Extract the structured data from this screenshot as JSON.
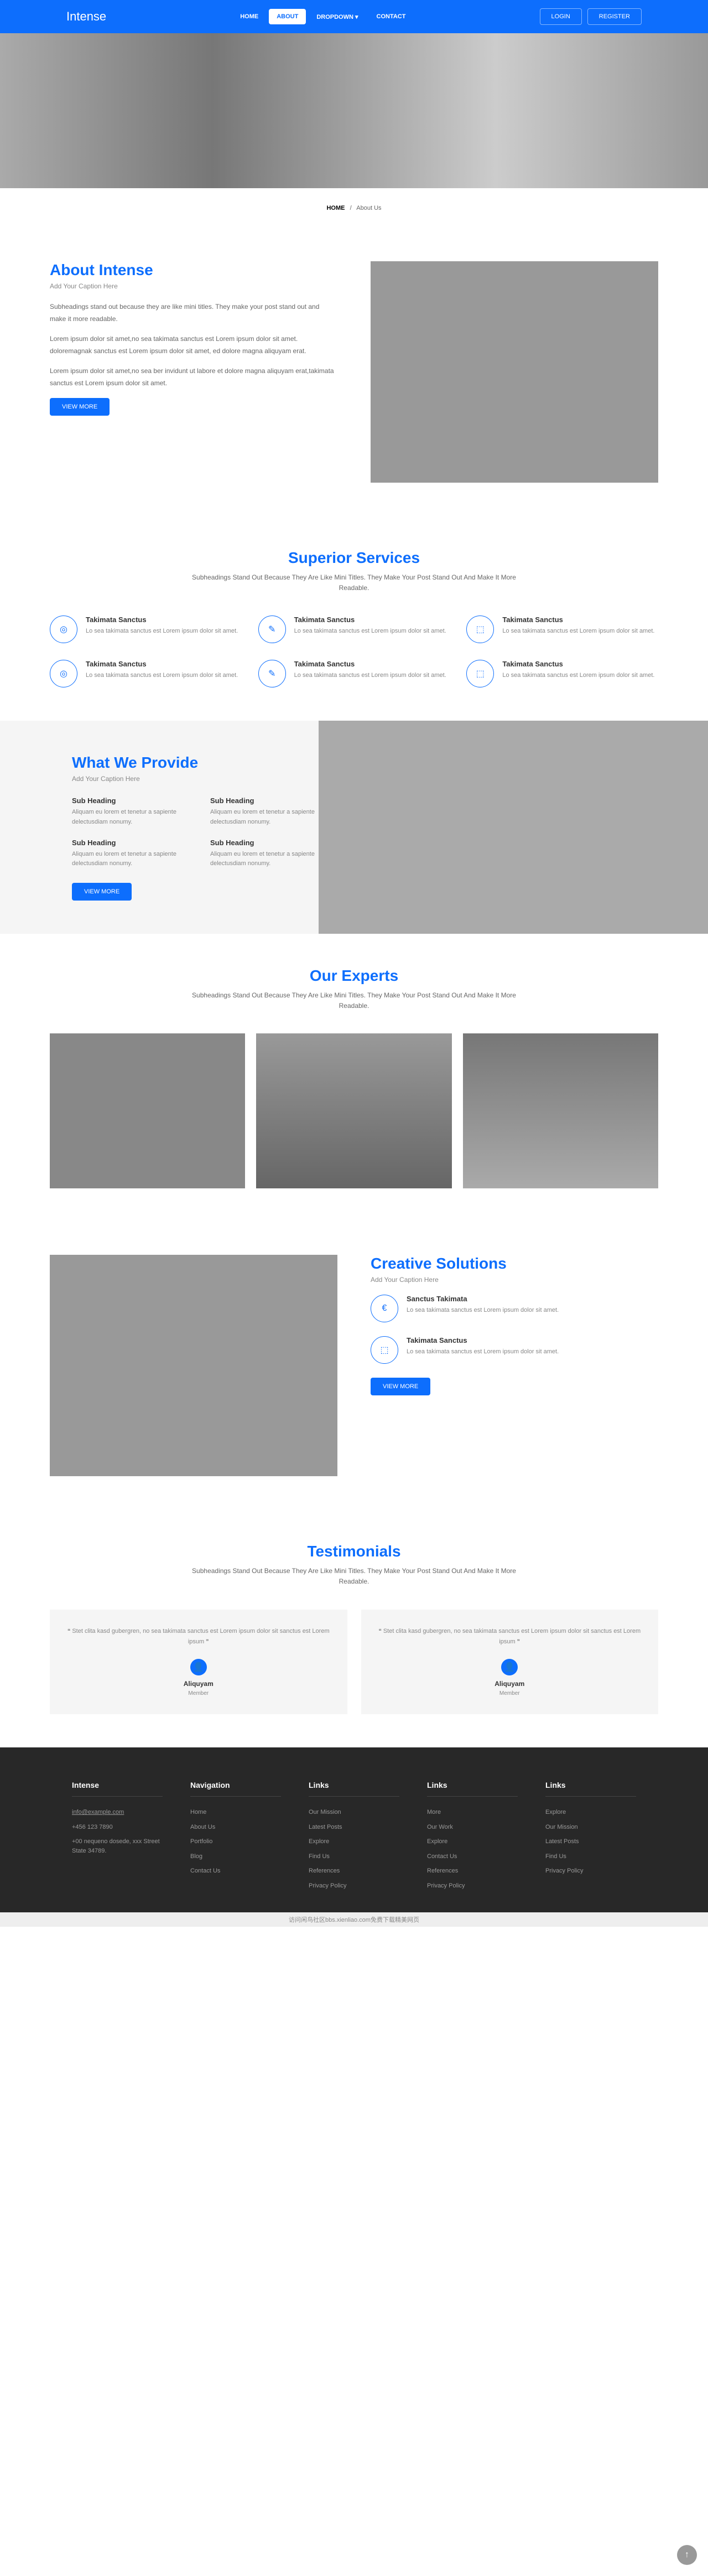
{
  "brand": "Intense",
  "nav": {
    "home": "HOME",
    "about": "ABOUT",
    "dropdown": "DROPDOWN ▾",
    "contact": "CONTACT"
  },
  "auth": {
    "login": "LOGIN",
    "register": "REGISTER"
  },
  "breadcrumb": {
    "home": "HOME",
    "sep": "/",
    "current": "About Us"
  },
  "about": {
    "title": "About Intense",
    "caption": "Add Your Caption Here",
    "p1": "Subheadings stand out because they are like mini titles. They make your post stand out and make it more readable.",
    "p2": "Lorem ipsum dolor sit amet,no sea takimata sanctus est Lorem ipsum dolor sit amet. doloremagnak sanctus est Lorem ipsum dolor sit amet, ed dolore magna aliquyam erat.",
    "p3": "Lorem ipsum dolor sit amet,no sea ber invidunt ut labore et dolore magna aliquyam erat,takimata sanctus est Lorem ipsum dolor sit amet.",
    "btn": "VIEW MORE"
  },
  "services": {
    "title": "Superior Services",
    "sub": "Subheadings Stand Out Because They Are Like Mini Titles. They Make Your Post Stand Out And Make It More Readable.",
    "items": [
      {
        "title": "Takimata Sanctus",
        "text": "Lo sea takimata sanctus est Lorem ipsum dolor sit amet."
      },
      {
        "title": "Takimata Sanctus",
        "text": "Lo sea takimata sanctus est Lorem ipsum dolor sit amet."
      },
      {
        "title": "Takimata Sanctus",
        "text": "Lo sea takimata sanctus est Lorem ipsum dolor sit amet."
      },
      {
        "title": "Takimata Sanctus",
        "text": "Lo sea takimata sanctus est Lorem ipsum dolor sit amet."
      },
      {
        "title": "Takimata Sanctus",
        "text": "Lo sea takimata sanctus est Lorem ipsum dolor sit amet."
      },
      {
        "title": "Takimata Sanctus",
        "text": "Lo sea takimata sanctus est Lorem ipsum dolor sit amet."
      }
    ]
  },
  "provide": {
    "title": "What We Provide",
    "caption": "Add Your Caption Here",
    "items": [
      {
        "title": "Sub Heading",
        "text": "Aliquam eu lorem et tenetur a sapiente delectusdiam nonumy."
      },
      {
        "title": "Sub Heading",
        "text": "Aliquam eu lorem et tenetur a sapiente delectusdiam nonumy."
      },
      {
        "title": "Sub Heading",
        "text": "Aliquam eu lorem et tenetur a sapiente delectusdiam nonumy."
      },
      {
        "title": "Sub Heading",
        "text": "Aliquam eu lorem et tenetur a sapiente delectusdiam nonumy."
      }
    ],
    "btn": "View More"
  },
  "experts": {
    "title": "Our Experts",
    "sub": "Subheadings Stand Out Because They Are Like Mini Titles. They Make Your Post Stand Out And Make It More Readable."
  },
  "creative": {
    "title": "Creative Solutions",
    "caption": "Add Your Caption Here",
    "items": [
      {
        "title": "Sanctus Takimata",
        "text": "Lo sea takimata sanctus est Lorem ipsum dolor sit amet."
      },
      {
        "title": "Takimata Sanctus",
        "text": "Lo sea takimata sanctus est Lorem ipsum dolor sit amet."
      }
    ],
    "btn": "View More"
  },
  "testimonials": {
    "title": "Testimonials",
    "sub": "Subheadings Stand Out Because They Are Like Mini Titles. They Make Your Post Stand Out And Make It More Readable.",
    "items": [
      {
        "text": "Stet clita kasd gubergren, no sea takimata sanctus est Lorem ipsum dolor sit sanctus est Lorem ipsum",
        "name": "Aliquyam",
        "role": "Member"
      },
      {
        "text": "Stet clita kasd gubergren, no sea takimata sanctus est Lorem ipsum dolor sit sanctus est Lorem ipsum",
        "name": "Aliquyam",
        "role": "Member"
      }
    ]
  },
  "footer": {
    "brand": "Intense",
    "contact": {
      "email": "info@example.com",
      "phone": "+456 123 7890",
      "addr": "+00 nequeno dosede, xxx Street State 34789."
    },
    "nav": {
      "title": "Navigation",
      "links": [
        "Home",
        "About Us",
        "Portfolio",
        "Blog",
        "Contact Us"
      ]
    },
    "links1": {
      "title": "Links",
      "links": [
        "Our Mission",
        "Latest Posts",
        "Explore",
        "Find Us",
        "References",
        "Privacy Policy"
      ]
    },
    "links2": {
      "title": "Links",
      "links": [
        "More",
        "Our Work",
        "Explore",
        "Contact Us",
        "References",
        "Privacy Policy"
      ]
    },
    "links3": {
      "title": "Links",
      "links": [
        "Explore",
        "Our Mission",
        "Latest Posts",
        "Find Us",
        "Privacy Policy"
      ]
    }
  },
  "watermark": "访问闲鸟社区bbs.xienliao.com免费下载精美网页"
}
